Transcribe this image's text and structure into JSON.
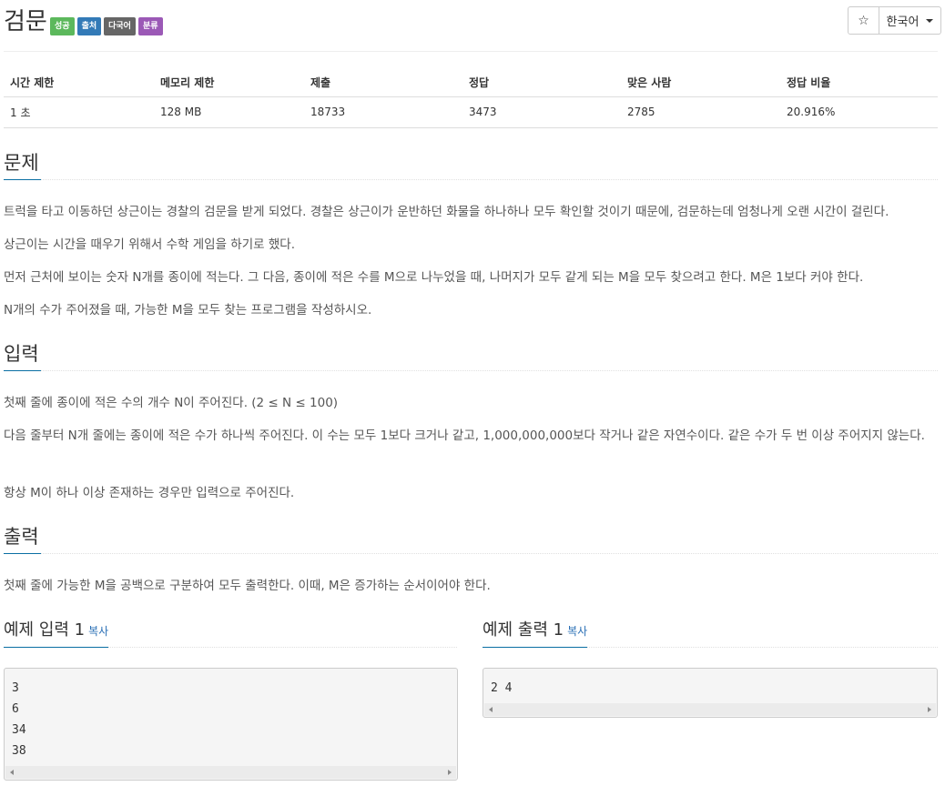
{
  "problem": {
    "title": "검문",
    "badges": [
      "성공",
      "출처",
      "다국어",
      "분류"
    ]
  },
  "controls": {
    "star_icon": "☆",
    "language": "한국어"
  },
  "info": {
    "headers": [
      "시간 제한",
      "메모리 제한",
      "제출",
      "정답",
      "맞은 사람",
      "정답 비율"
    ],
    "values": [
      "1 초",
      "128 MB",
      "18733",
      "3473",
      "2785",
      "20.916%"
    ]
  },
  "sections": {
    "problem_title": "문제",
    "problem_paragraphs": [
      "트럭을 타고 이동하던 상근이는 경찰의 검문을 받게 되었다. 경찰은 상근이가 운반하던 화물을 하나하나 모두 확인할 것이기 때문에, 검문하는데 엄청나게 오랜 시간이 걸린다.",
      "상근이는 시간을 때우기 위해서 수학 게임을 하기로 했다.",
      "먼저 근처에 보이는 숫자 N개를 종이에 적는다. 그 다음, 종이에 적은 수를 M으로 나누었을 때, 나머지가 모두 같게 되는 M을 모두 찾으려고 한다. M은 1보다 커야 한다.",
      "N개의 수가 주어졌을 때, 가능한 M을 모두 찾는 프로그램을 작성하시오."
    ],
    "input_title": "입력",
    "input_paragraphs": [
      "첫째 줄에 종이에 적은 수의 개수 N이 주어진다. (2 ≤ N ≤ 100)",
      "다음 줄부터 N개 줄에는 종이에 적은 수가 하나씩 주어진다. 이 수는 모두 1보다 크거나 같고, 1,000,000,000보다 작거나 같은 자연수이다. 같은 수가 두 번 이상 주어지지 않는다.",
      "항상 M이 하나 이상 존재하는 경우만 입력으로 주어진다."
    ],
    "output_title": "출력",
    "output_paragraphs": [
      "첫째 줄에 가능한 M을 공백으로 구분하여 모두 출력한다. 이때, M은 증가하는 순서이어야 한다."
    ]
  },
  "samples": {
    "input_title": "예제 입력 1",
    "output_title": "예제 출력 1",
    "copy_label": "복사",
    "input_lines": "3\n6\n34\n38",
    "output_lines": "2 4"
  }
}
